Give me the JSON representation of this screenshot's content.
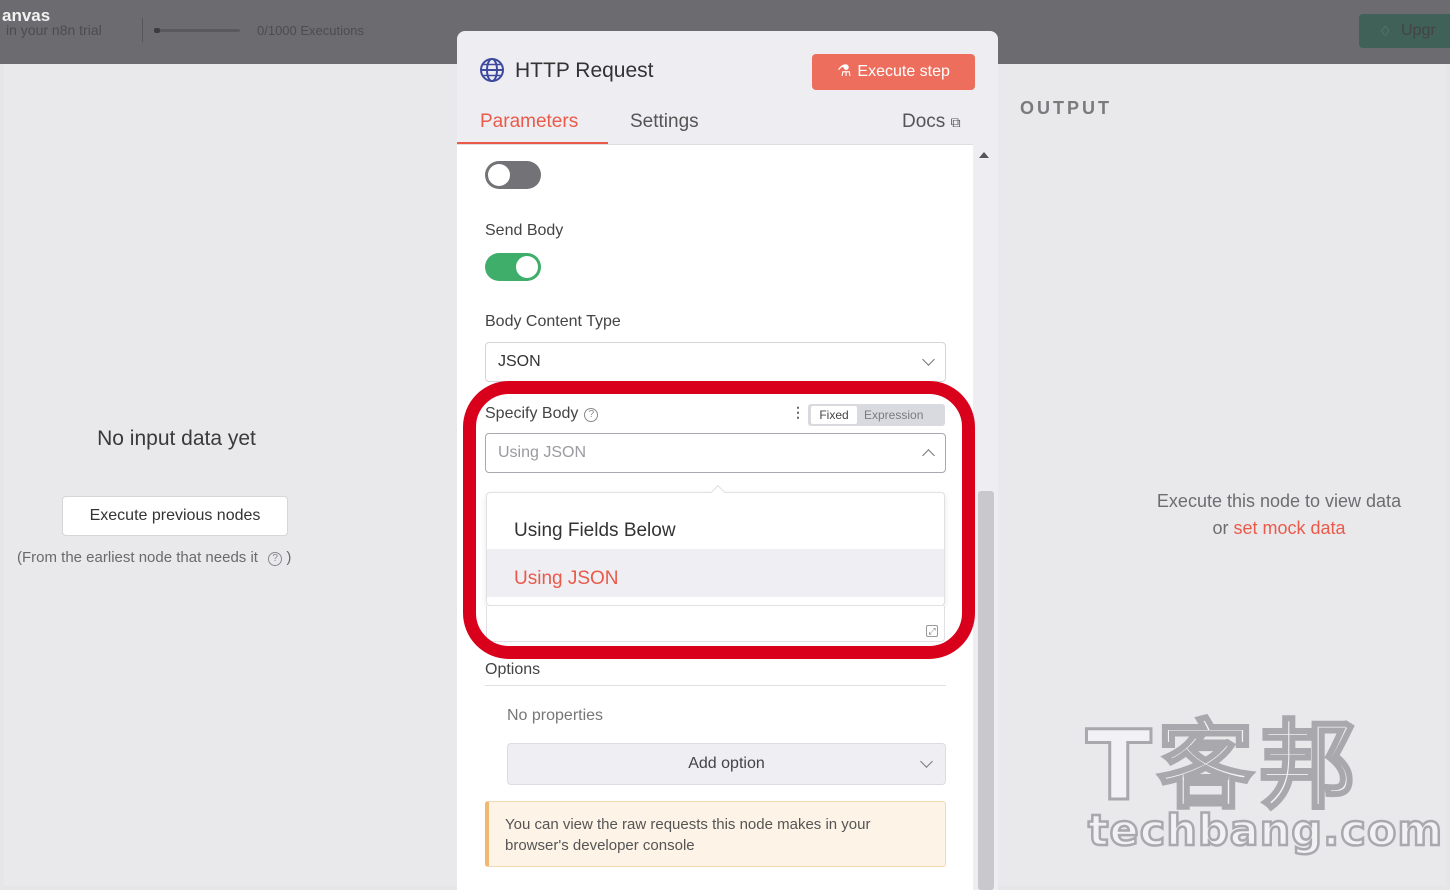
{
  "topbar": {
    "title": "anvas",
    "trial_text": "in your n8n trial",
    "executions": "0/1000 Executions",
    "upgrade_label": "Upgr"
  },
  "input_panel": {
    "empty_title": "No input data yet",
    "execute_previous_label": "Execute previous nodes",
    "hint": "(From the earliest node that needs it",
    "hint_close": ")"
  },
  "node": {
    "title": "HTTP Request",
    "icon": "globe-icon",
    "execute_step_label": "Execute step",
    "tabs": [
      {
        "label": "Parameters",
        "active": true
      },
      {
        "label": "Settings",
        "active": false
      },
      {
        "label": "Docs",
        "active": false
      }
    ],
    "parameters": {
      "top_toggle_on": false,
      "send_body_label": "Send Body",
      "send_body_on": true,
      "body_content_type_label": "Body Content Type",
      "body_content_type_value": "JSON",
      "specify_body_label": "Specify Body",
      "mode_fixed": "Fixed",
      "mode_expression": "Expression",
      "specify_body_value": "Using JSON",
      "dropdown_options": [
        {
          "label": "Using Fields Below",
          "selected": false
        },
        {
          "label": "Using JSON",
          "selected": true
        }
      ],
      "options_label": "Options",
      "no_properties": "No properties",
      "add_option_label": "Add option",
      "notice": "You can view the raw requests this node makes in your browser's developer console"
    }
  },
  "output_panel": {
    "label": "OUTPUT",
    "empty_line1": "Execute this node to view data",
    "empty_or": "or",
    "mock_link": "set mock data"
  },
  "watermark": {
    "cn": "T客邦",
    "en": "techbang.com"
  },
  "colors": {
    "accent": "#ea5a4a",
    "toggle_on": "#3fae6a",
    "annotation_red": "#d9001b"
  }
}
